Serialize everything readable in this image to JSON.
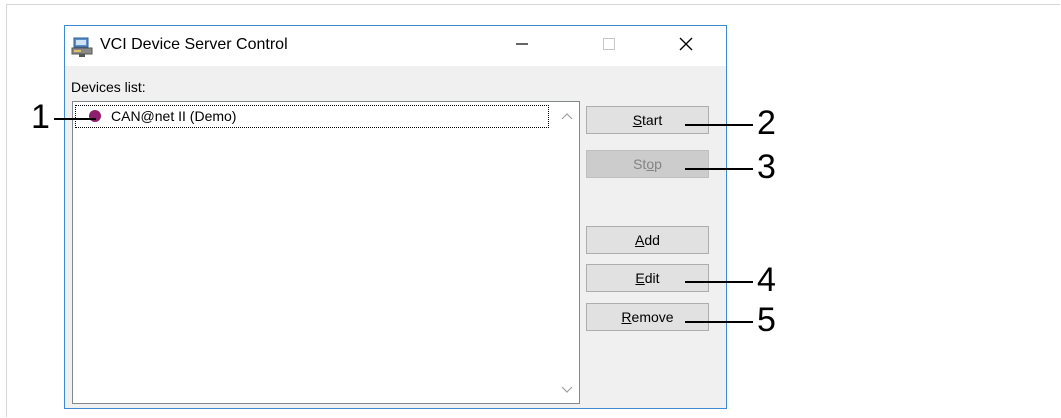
{
  "window": {
    "title": "VCI Device Server Control"
  },
  "devices": {
    "label": "Devices list:",
    "items": [
      {
        "label": "CAN@net II (Demo)",
        "icon": "device-status-icon",
        "icon_color": "#8f1f6e"
      }
    ]
  },
  "buttons": {
    "start": {
      "label": "Start",
      "mnemonic": "S",
      "rest": "tart"
    },
    "stop": {
      "label": "Stop",
      "pre": "St",
      "mnemonic": "o",
      "rest": "p",
      "disabled": true
    },
    "add": {
      "label": "Add",
      "mnemonic": "A",
      "rest": "dd"
    },
    "edit": {
      "label": "Edit",
      "mnemonic": "E",
      "rest": "dit"
    },
    "remove": {
      "label": "Remove",
      "mnemonic": "R",
      "rest": "emove"
    }
  },
  "callouts": [
    "1",
    "2",
    "3",
    "4",
    "5"
  ],
  "colors": {
    "window_border": "#3c8bd1",
    "dialog_bg": "#f0f0f0",
    "button_bg": "#e1e1e1",
    "disabled_button_bg": "#cccccc"
  }
}
